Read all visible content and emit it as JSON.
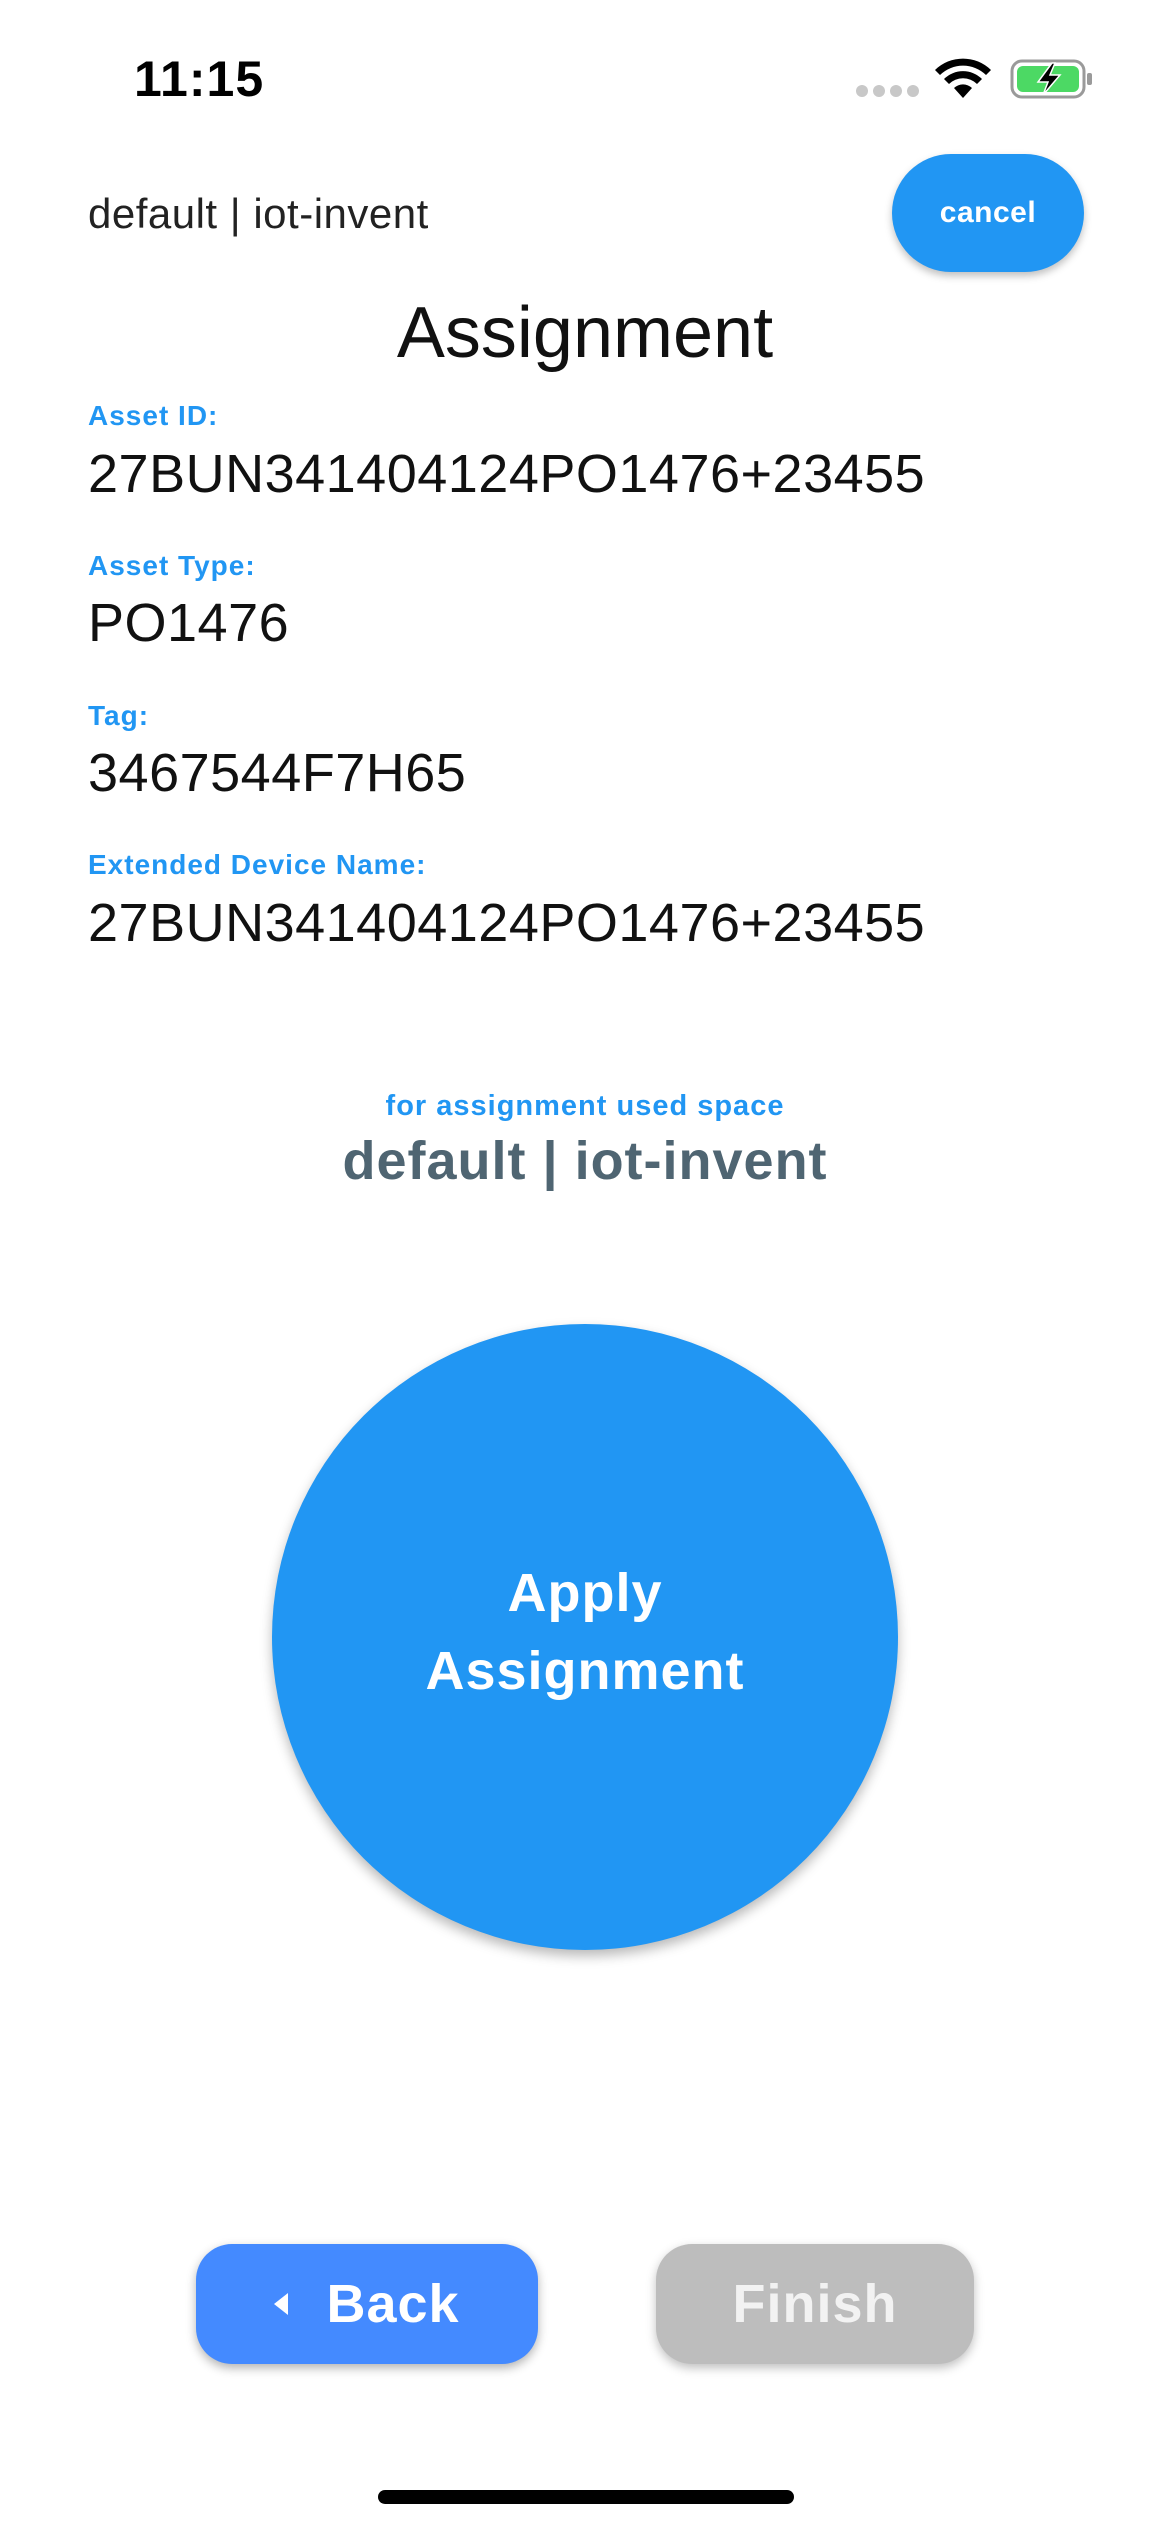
{
  "status_bar": {
    "time": "11:15",
    "icons": [
      "cellular-signal-icon",
      "wifi-icon",
      "battery-charging-icon"
    ],
    "battery_color": "#4cd964"
  },
  "header": {
    "space_label": "default | iot-invent",
    "cancel_label": "cancel"
  },
  "page": {
    "title": "Assignment"
  },
  "fields": [
    {
      "label": "Asset ID:",
      "value": "27BUN341404124PO1476+23455"
    },
    {
      "label": "Asset Type:",
      "value": "PO1476"
    },
    {
      "label": "Tag:",
      "value": "3467544F7H65"
    },
    {
      "label": "Extended Device Name:",
      "value": "27BUN341404124PO1476+23455"
    }
  ],
  "assignment_space": {
    "caption": "for assignment used space",
    "value": "default | iot-invent"
  },
  "apply_button": {
    "label": "Apply Assignment"
  },
  "footer": {
    "back_label": "Back",
    "finish_label": "Finish"
  },
  "colors": {
    "accent": "#2196F3",
    "back_button": "#448AFF",
    "finish_disabled": "#bdbdbd",
    "space_value": "#4f6572"
  }
}
